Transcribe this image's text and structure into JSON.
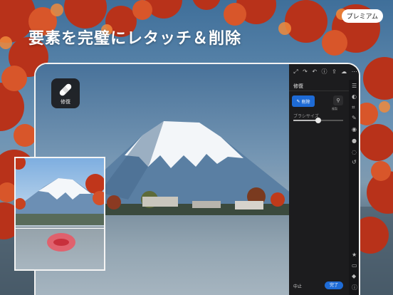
{
  "promo": {
    "title": "要素を完璧にレタッチ＆削除",
    "badge": "プレミアム"
  },
  "tool_chip": {
    "label": "修復",
    "icon": "bandage-icon"
  },
  "panel": {
    "title": "修復",
    "remove_label": "削除",
    "tool2_label": "複製",
    "brush_size_label": "ブラシサイズ",
    "brush_size_value": 0.5,
    "cancel_label": "中止",
    "done_label": "完了",
    "accent_color": "#1e6bd6",
    "top_icons": [
      "expand-icon",
      "redo-icon",
      "undo-icon",
      "info-icon",
      "share-icon",
      "cloud-icon",
      "more-icon"
    ],
    "rail_icons": [
      "sliders-icon",
      "presets-icon",
      "crop-icon",
      "heal-brush-icon",
      "mask-icon",
      "color-drop-icon",
      "blur-icon",
      "history-icon",
      "star-icon",
      "comment-icon",
      "tag-icon",
      "info-circle-icon"
    ]
  }
}
